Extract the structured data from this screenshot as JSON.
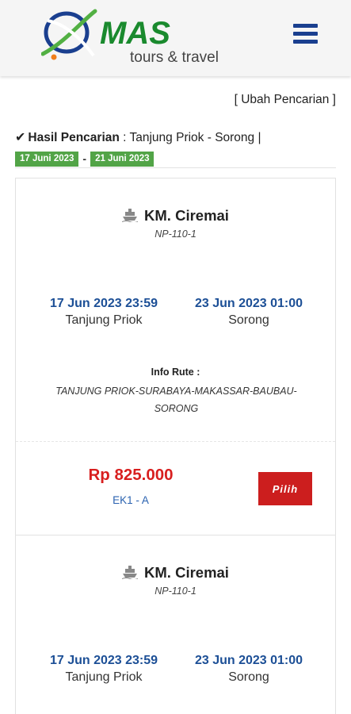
{
  "header": {
    "brand_name": "MAS",
    "brand_tagline": "tours & travel",
    "brand_color": "#1a8a2e",
    "menu_icon": "hamburger-icon"
  },
  "search": {
    "edit_label": "[ Ubah Pencarian ]",
    "result_prefix": "Hasil Pencarian",
    "result_route": " : Tanjung Priok - Sorong |",
    "date_from": "17 Juni 2023",
    "date_separator": "-",
    "date_to": "21 Juni 2023",
    "badge_color": "#52a447"
  },
  "results": [
    {
      "ship_name": "KM. Ciremai",
      "ship_code": "NP-110-1",
      "depart_datetime": "17 Jun 2023 23:59",
      "depart_port": "Tanjung Priok",
      "arrive_datetime": "23 Jun 2023 01:00",
      "arrive_port": "Sorong",
      "route_label": "Info Rute :",
      "route_text": "TANJUNG PRIOK-SURABAYA-MAKASSAR-BAUBAU-SORONG",
      "price": "Rp 825.000",
      "class_code": "EK1  -  A",
      "select_label": "Pilih"
    },
    {
      "ship_name": "KM. Ciremai",
      "ship_code": "NP-110-1",
      "depart_datetime": "17 Jun 2023 23:59",
      "depart_port": "Tanjung Priok",
      "arrive_datetime": "23 Jun 2023 01:00",
      "arrive_port": "Sorong"
    }
  ]
}
